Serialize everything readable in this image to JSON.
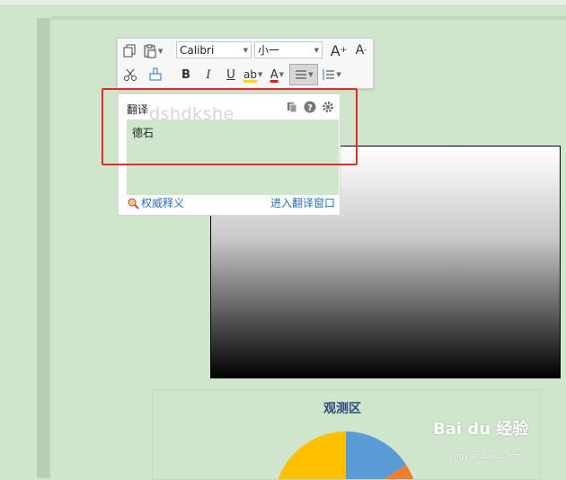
{
  "toolbar": {
    "font_name": "Calibri",
    "font_size": "小一",
    "grow_font": "A",
    "shrink_font": "A",
    "bold": "B",
    "italic": "I",
    "underline": "U",
    "highlight": "ab",
    "font_color": "A"
  },
  "translate": {
    "title": "翻译",
    "result": "德石",
    "watermark": "dshdkshe",
    "authority_link": "权威释义",
    "window_link": "进入翻译窗口"
  },
  "chart": {
    "title": "观测区",
    "colors": {
      "blue": "#5b9bd5",
      "orange": "#ed7d31",
      "yellow": "#ffc000"
    }
  },
  "watermark_brand": {
    "logo": "Bai du 经验",
    "url": "jingyan.baidu.com"
  }
}
